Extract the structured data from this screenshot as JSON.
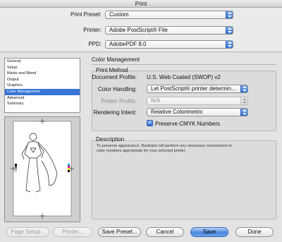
{
  "window": {
    "title": "Print"
  },
  "top": {
    "preset_label": "Print Preset:",
    "preset_value": "Custom",
    "printer_label": "Printer:",
    "printer_value": "Adobe PostScript® File",
    "ppd_label": "PPD:",
    "ppd_value": "AdobePDF 8.0"
  },
  "sidebar": {
    "items": [
      {
        "label": "General"
      },
      {
        "label": "Setup"
      },
      {
        "label": "Marks and Bleed"
      },
      {
        "label": "Output"
      },
      {
        "label": "Graphics"
      },
      {
        "label": "Color Management",
        "selected": true
      },
      {
        "label": "Advanced"
      },
      {
        "label": "Summary"
      }
    ]
  },
  "main": {
    "section_title": "Color Management",
    "print_method": {
      "title": "Print Method",
      "doc_profile_label": "Document Profile:",
      "doc_profile_value": "U.S. Web Coated (SWOP) v2",
      "color_handling_label": "Color Handling:",
      "color_handling_value": "Let PostScript® printer determin...",
      "printer_profile_label": "Printer Profile:",
      "printer_profile_value": "N/A",
      "rendering_intent_label": "Rendering Intent:",
      "rendering_intent_value": "Relative Colorimetric",
      "preserve_cmyk_label": "Preserve CMYK Numbers",
      "preserve_cmyk_checked": true
    },
    "description": {
      "title": "Description",
      "line1": "To preserve appearance, Illustrator will perform any necessary conversions to",
      "line2": "color numbers appropriate for your selected printer."
    }
  },
  "buttons": {
    "page_setup": "Page Setup...",
    "printer": "Printer...",
    "save_preset": "Save Preset...",
    "cancel": "Cancel",
    "save": "Save",
    "done": "Done"
  },
  "colors": {
    "accent": "#3875d7",
    "primary_button": "#4b89de"
  }
}
